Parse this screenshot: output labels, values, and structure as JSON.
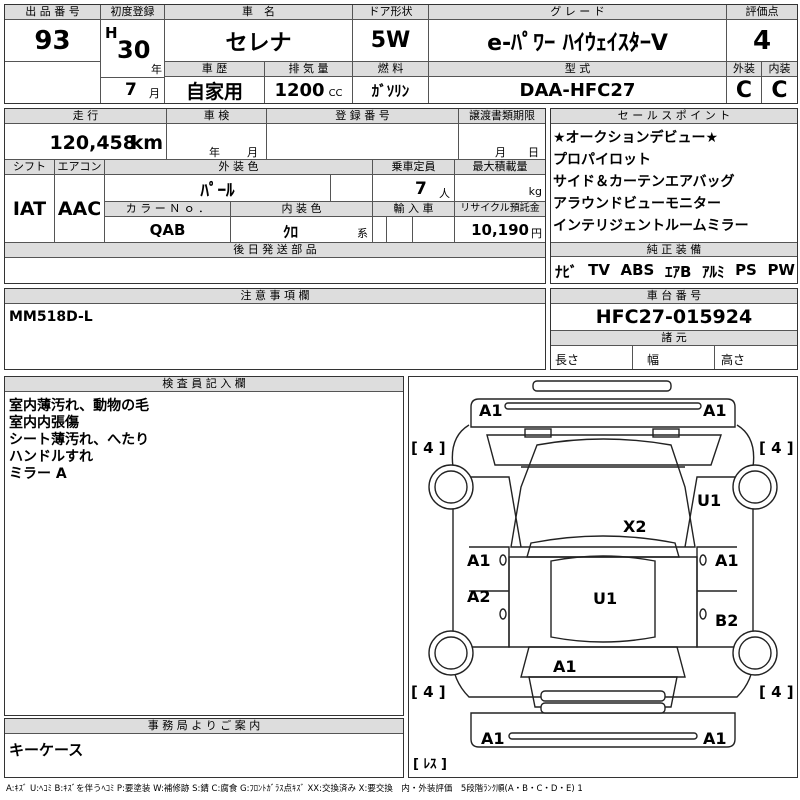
{
  "header": {
    "lot_no": {
      "label": "出 品 番 号",
      "value": "93"
    },
    "first_reg": {
      "label": "初度登録",
      "era": "H",
      "year": "30",
      "year_unit": "年",
      "month": "7",
      "month_unit": "月"
    },
    "car_name": {
      "label": "車　名",
      "value": "セレナ"
    },
    "door": {
      "label": "ドア形状",
      "value": "5W"
    },
    "grade": {
      "label": "グ レ ー ド",
      "value": "e-ﾊﾟﾜｰ ﾊｲｳｪｲｽﾀｰV"
    },
    "score": {
      "label": "評価点",
      "value": "4"
    },
    "history": {
      "label": "車 歴",
      "value": "自家用"
    },
    "displacement": {
      "label": "排 気 量",
      "value": "1200",
      "unit": "CC"
    },
    "fuel": {
      "label": "燃 料",
      "value": "ｶﾞｿﾘﾝ"
    },
    "model": {
      "label": "型 式",
      "value": "DAA-HFC27"
    },
    "exterior": {
      "label": "外装",
      "value": "C"
    },
    "interior": {
      "label": "内装",
      "value": "C"
    }
  },
  "row2": {
    "mileage": {
      "label": "走 行",
      "value": "120,458",
      "unit": "km"
    },
    "inspection": {
      "label": "車 検",
      "year_unit": "年",
      "month_unit": "月"
    },
    "reg_no": {
      "label": "登 録 番 号"
    },
    "transfer": {
      "label": "譲渡書類期限",
      "month_unit": "月",
      "day_unit": "日"
    },
    "shift": {
      "label": "シフト",
      "value": "IAT"
    },
    "aircon": {
      "label": "エアコン",
      "value": "AAC"
    },
    "color": {
      "label": "外 装 色",
      "value": "ﾊﾟｰﾙ"
    },
    "capacity": {
      "label": "乗車定員",
      "value": "7",
      "unit": "人"
    },
    "max_load": {
      "label": "最大積載量",
      "unit": "kg"
    },
    "color_no": {
      "label": "カ ラ ー Ｎ ｏ ．",
      "value": "QAB"
    },
    "int_color": {
      "label": "内 装 色",
      "value": "ｸﾛ",
      "unit": "系"
    },
    "import": {
      "label": "輸 入 車"
    },
    "recycle": {
      "label": "リサイクル預託金",
      "value": "10,190",
      "unit": "円"
    },
    "later_parts": {
      "label": "後 日 発 送 部 品"
    }
  },
  "sales_points": {
    "label": "セ ー ル ス ポ イ ン ト",
    "items": [
      "★オークションデビュー★",
      "プロパイロット",
      "サイド＆カーテンエアバッグ",
      "アラウンドビューモニター",
      "インテリジェントルームミラー"
    ]
  },
  "equipment": {
    "label": "純 正 装 備",
    "items": [
      "ﾅﾋﾞ",
      "TV",
      "ABS",
      "ｴｱB",
      "ｱﾙﾐ",
      "PS",
      "PW"
    ]
  },
  "notes": {
    "label": "注 意 事 項 欄",
    "value": "MM518D-L"
  },
  "chassis": {
    "label": "車 台 番 号",
    "value": "HFC27-015924",
    "dims_label": "諸 元",
    "length": "長さ",
    "width": "幅",
    "height": "高さ"
  },
  "inspector": {
    "label": "検 査 員 記 入 欄",
    "lines": [
      "室内薄汚れ、動物の毛",
      "室内内張傷",
      "シート薄汚れ、へたり",
      "ハンドルすれ",
      "ミラー A"
    ]
  },
  "office": {
    "label": "事 務 局 よ り ご 案 内",
    "value": "キーケース"
  },
  "diagram": {
    "marks": [
      "A1",
      "A1",
      "U1",
      "X2",
      "A1",
      "A1",
      "A2",
      "U1",
      "B2",
      "A1",
      "A1",
      "A1"
    ],
    "brackets": [
      "[ 4 ]",
      "[ 4 ]",
      "[ 4 ]",
      "[ 4 ]"
    ],
    "spare": "[ ﾚｽ ]"
  },
  "legend": "A:ｷｽﾞ U:ﾍｺﾐ B:ｷｽﾞを伴うﾍｺﾐ P:要塗装 W:補修跡 S:錆 C:腐食 G:ﾌﾛﾝﾄｶﾞﾗｽ点ｷｽﾞ XX:交換済み X:要交換　内・外装評価　5段階ﾗﾝｸ順(A・B・C・D・E) 1"
}
